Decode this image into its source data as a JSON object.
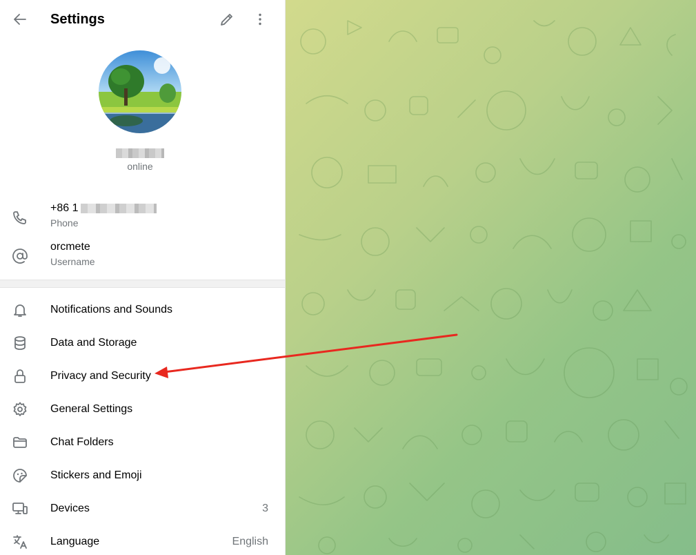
{
  "header": {
    "title": "Settings",
    "back_icon": "arrow-left-icon",
    "edit_icon": "pencil-icon",
    "more_icon": "more-vertical-icon"
  },
  "profile": {
    "name": "g",
    "status": "online"
  },
  "info": [
    {
      "value": "+86 1",
      "label": "Phone",
      "icon": "phone-icon"
    },
    {
      "value": "orcmete",
      "label": "Username",
      "icon": "at-sign-icon"
    }
  ],
  "menu": [
    {
      "label": "Notifications and Sounds",
      "icon": "bell-icon",
      "value": ""
    },
    {
      "label": "Data and Storage",
      "icon": "database-icon",
      "value": ""
    },
    {
      "label": "Privacy and Security",
      "icon": "lock-icon",
      "value": ""
    },
    {
      "label": "General Settings",
      "icon": "gear-icon",
      "value": ""
    },
    {
      "label": "Chat Folders",
      "icon": "folder-icon",
      "value": ""
    },
    {
      "label": "Stickers and Emoji",
      "icon": "sticker-icon",
      "value": ""
    },
    {
      "label": "Devices",
      "icon": "devices-icon",
      "value": "3"
    },
    {
      "label": "Language",
      "icon": "translate-icon",
      "value": "English"
    }
  ],
  "colors": {
    "icon_gray": "#707579",
    "secondary_text": "#707579",
    "annotation_arrow": "#e8281f",
    "background_gradient_start": "#d2da8c",
    "background_gradient_end": "#85bd8a"
  }
}
